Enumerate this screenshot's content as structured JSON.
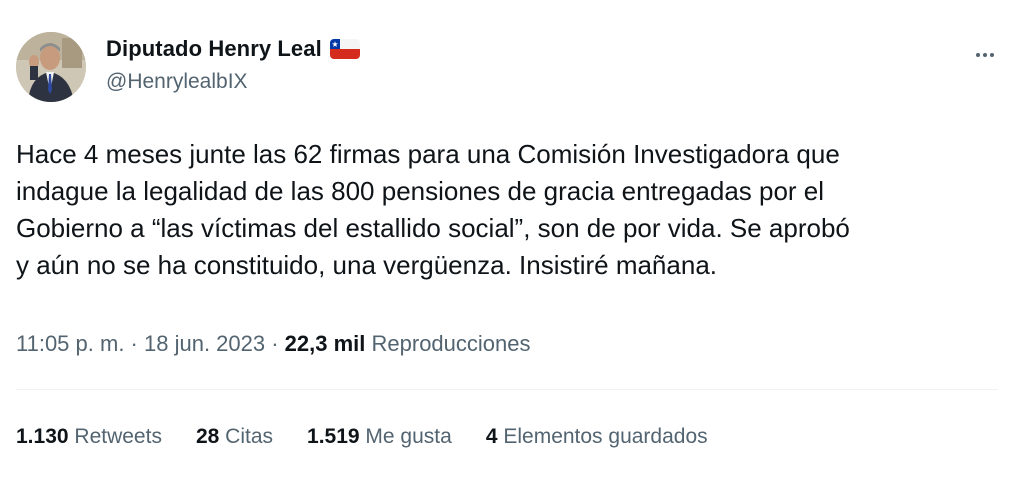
{
  "author": {
    "display_name": "Diputado Henry Leal",
    "flag": "chile-flag-icon",
    "handle": "@HenrylealbIX",
    "avatar": "avatar-photo"
  },
  "more_icon": "more-horizontal-icon",
  "tweet": {
    "lines": [
      "Hace 4 meses junte las 62 firmas para una Comisión Investigadora que",
      "indague la legalidad de las 800 pensiones de gracia entregadas por el",
      "Gobierno a “las víctimas del estallido social”, son de por vida. Se aprobó",
      "y aún no se ha constituido, una vergüenza. Insistiré mañana."
    ]
  },
  "meta": {
    "time": "11:05 p. m.",
    "sep1": " · ",
    "date": "18 jun. 2023",
    "sep2": " · ",
    "views_count": "22,3 mil",
    "views_label": "Reproducciones"
  },
  "stats": [
    {
      "count": "1.130",
      "label": "Retweets"
    },
    {
      "count": "28",
      "label": "Citas"
    },
    {
      "count": "1.519",
      "label": "Me gusta"
    },
    {
      "count": "4",
      "label": "Elementos guardados"
    }
  ],
  "colors": {
    "text_primary": "#0f1419",
    "text_secondary": "#536471",
    "divider": "#eff3f4",
    "flag_red": "#d52b1e",
    "flag_blue": "#0039a6"
  }
}
